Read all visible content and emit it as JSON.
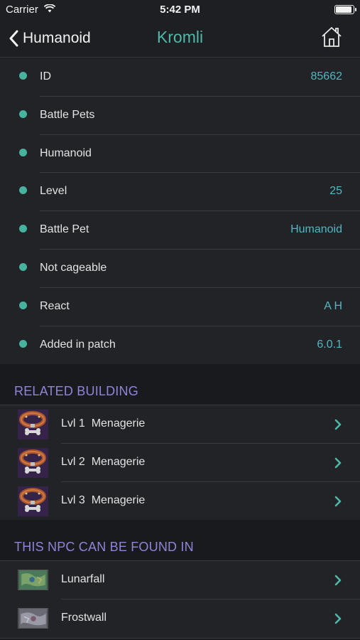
{
  "status_bar": {
    "carrier": "Carrier",
    "time": "5:42 PM",
    "battery_level": 0.95
  },
  "nav": {
    "back_label": "Humanoid",
    "title": "Kromli"
  },
  "info_rows": [
    {
      "label": "ID",
      "value": "85662"
    },
    {
      "label": "Battle Pets",
      "value": ""
    },
    {
      "label": "Humanoid",
      "value": ""
    },
    {
      "label": "Level",
      "value": "25"
    },
    {
      "label": "Battle Pet",
      "value": "Humanoid"
    },
    {
      "label": "Not cageable",
      "value": ""
    },
    {
      "label": "React",
      "value": "A H"
    },
    {
      "label": "Added in patch",
      "value": "6.0.1"
    }
  ],
  "related_building": {
    "title": "RELATED BUILDING",
    "items": [
      {
        "label": "Lvl 1  Menagerie"
      },
      {
        "label": "Lvl 2  Menagerie"
      },
      {
        "label": "Lvl 3  Menagerie"
      }
    ]
  },
  "found_in": {
    "title": "THIS NPC CAN BE FOUND IN",
    "items": [
      {
        "label": "Lunarfall"
      },
      {
        "label": "Frostwall"
      }
    ]
  },
  "colors": {
    "accent": "#4fb8a8",
    "value": "#4fb8c4",
    "section": "#8d85d8",
    "dot": "#46b39f"
  }
}
